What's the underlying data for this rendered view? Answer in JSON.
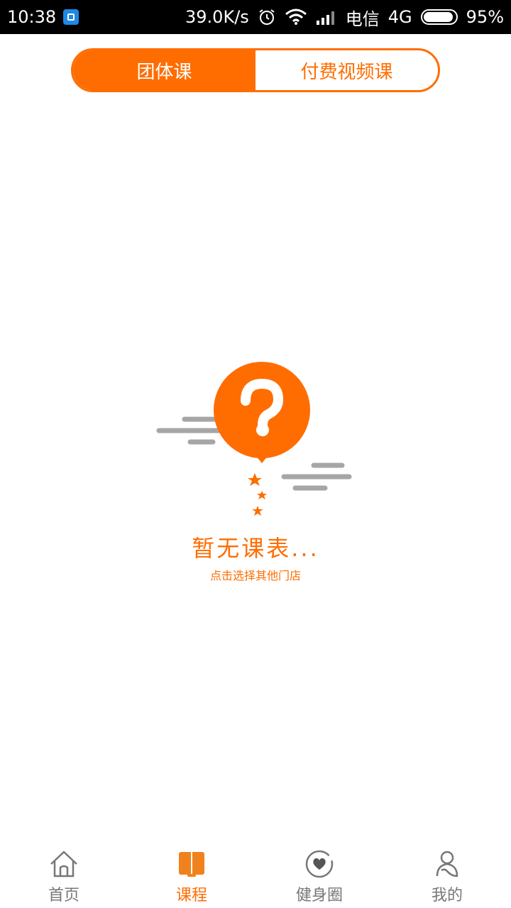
{
  "status_bar": {
    "time": "10:38",
    "speed": "39.0K/s",
    "carrier": "电信",
    "network": "4G",
    "battery": "95%",
    "battery_level": 0.95,
    "icons": [
      "calendar-icon",
      "alarm-icon",
      "wifi-icon",
      "signal-icon",
      "battery-icon"
    ]
  },
  "tabs": [
    {
      "label": "团体课",
      "active": true
    },
    {
      "label": "付费视频课",
      "active": false
    }
  ],
  "empty_state": {
    "title": "暂无课表...",
    "subtitle": "点击选择其他门店",
    "icon": "question-balloon-icon"
  },
  "bottom_nav": {
    "items": [
      {
        "label": "首页",
        "icon": "home-icon",
        "active": false
      },
      {
        "label": "课程",
        "icon": "book-icon",
        "active": true
      },
      {
        "label": "健身圈",
        "icon": "heart-circle-icon",
        "active": false
      },
      {
        "label": "我的",
        "icon": "user-icon",
        "active": false
      }
    ]
  },
  "colors": {
    "accent": "#ff6d00",
    "inactive": "#777777",
    "cloud": "#a6a6a6"
  }
}
